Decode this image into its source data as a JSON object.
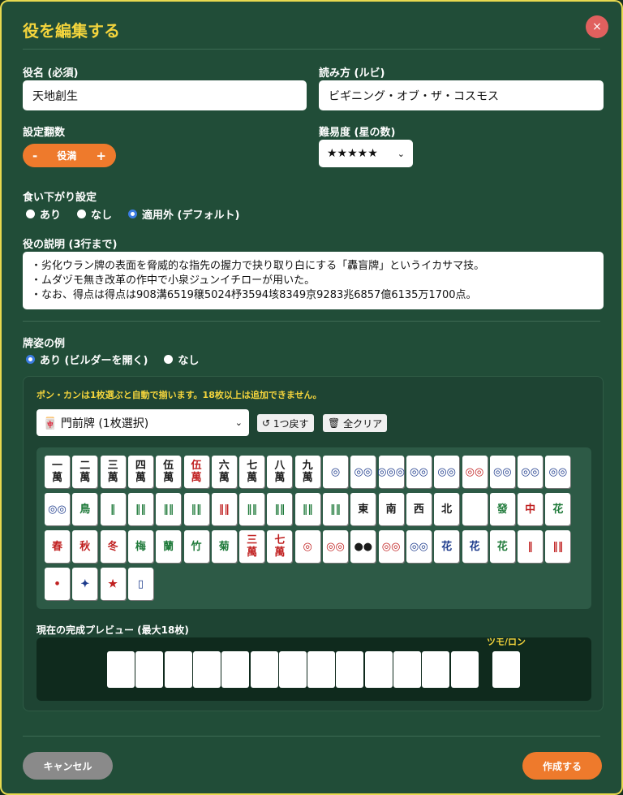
{
  "dialog": {
    "title": "役を編集する",
    "close_label": "×",
    "cancel_label": "キャンセル",
    "create_label": "作成する"
  },
  "fields": {
    "name_label": "役名 (必須)",
    "name_value": "天地創生",
    "reading_label": "読み方 (ルビ)",
    "reading_value": "ビギニング・オブ・ザ・コスモス",
    "han_label": "設定翻数",
    "han_minus": "-",
    "han_value": "役満",
    "han_plus": "+",
    "difficulty_label": "難易度 (星の数)",
    "difficulty_value": "★★★★★",
    "kuisagari_label": "食い下がり設定",
    "kuisagari_options": [
      "あり",
      "なし",
      "適用外 (デフォルト)"
    ],
    "kuisagari_selected": 2,
    "description_label": "役の説明 (3行まで)",
    "description_lines": [
      "・劣化ウラン牌の表面を脅威的な指先の握力で抉り取り白にする「轟盲牌」というイカサマ技。",
      "・ムダヅモ無き改革の作中で小泉ジュンイチローが用いた。",
      "・なお、得点は得点は908溝6519穣5024杼3594垓8349京9283兆6857億6135万1700点。"
    ],
    "example_label": "牌姿の例",
    "example_options": [
      "あり (ビルダーを開く)",
      "なし"
    ],
    "example_selected": 0
  },
  "builder": {
    "notice": "ポン・カンは1枚選ぶと自動で揃います。18枚以上は追加できません。",
    "tile_select_value": "門前牌 (1枚選択)",
    "tile_select_icon": "🀄",
    "undo_label": "1つ戻す",
    "undo_icon": "↺",
    "clear_label": "全クリア",
    "clear_icon": "🗑",
    "preview_label": "現在の完成プレビュー (最大18枚)",
    "tsumo_label": "ツモ/ロン",
    "tiles": [
      {
        "t": "一\n萬",
        "c": "bk"
      },
      {
        "t": "二\n萬",
        "c": "bk"
      },
      {
        "t": "三\n萬",
        "c": "bk"
      },
      {
        "t": "四\n萬",
        "c": "bk"
      },
      {
        "t": "伍\n萬",
        "c": "bk"
      },
      {
        "t": "伍\n萬",
        "c": "rd"
      },
      {
        "t": "六\n萬",
        "c": "bk"
      },
      {
        "t": "七\n萬",
        "c": "bk"
      },
      {
        "t": "八\n萬",
        "c": "bk"
      },
      {
        "t": "九\n萬",
        "c": "bk"
      },
      {
        "t": "◎",
        "c": "bl"
      },
      {
        "t": "◎◎",
        "c": "bl"
      },
      {
        "t": "◎◎◎",
        "c": "bl"
      },
      {
        "t": "◎◎",
        "c": "bl"
      },
      {
        "t": "◎◎",
        "c": "bl"
      },
      {
        "t": "◎◎",
        "c": "rd"
      },
      {
        "t": "◎◎",
        "c": "bl"
      },
      {
        "t": "◎◎",
        "c": "bl"
      },
      {
        "t": "◎◎",
        "c": "bl"
      },
      {
        "t": "◎◎",
        "c": "bl"
      },
      {
        "t": "鳥",
        "c": "gr"
      },
      {
        "t": "‖",
        "c": "gr"
      },
      {
        "t": "‖‖",
        "c": "gr"
      },
      {
        "t": "‖‖",
        "c": "gr"
      },
      {
        "t": "‖‖",
        "c": "gr"
      },
      {
        "t": "‖‖",
        "c": "rd"
      },
      {
        "t": "‖‖",
        "c": "gr"
      },
      {
        "t": "‖‖",
        "c": "gr"
      },
      {
        "t": "‖‖",
        "c": "gr"
      },
      {
        "t": "‖‖",
        "c": "gr"
      },
      {
        "t": "東",
        "c": "bk"
      },
      {
        "t": "南",
        "c": "bk"
      },
      {
        "t": "西",
        "c": "bk"
      },
      {
        "t": "北",
        "c": "bk"
      },
      {
        "t": "",
        "c": "bk"
      },
      {
        "t": "發",
        "c": "gr"
      },
      {
        "t": "中",
        "c": "rd"
      },
      {
        "t": "花",
        "c": "gr"
      },
      {
        "t": "春",
        "c": "rd"
      },
      {
        "t": "秋",
        "c": "rd"
      },
      {
        "t": "冬",
        "c": "rd"
      },
      {
        "t": "梅",
        "c": "gr"
      },
      {
        "t": "蘭",
        "c": "gr"
      },
      {
        "t": "竹",
        "c": "gr"
      },
      {
        "t": "菊",
        "c": "gr"
      },
      {
        "t": "三\n萬",
        "c": "rd"
      },
      {
        "t": "七\n萬",
        "c": "rd"
      },
      {
        "t": "◎",
        "c": "rd"
      },
      {
        "t": "◎◎",
        "c": "rd"
      },
      {
        "t": "●●",
        "c": "bk"
      },
      {
        "t": "◎◎",
        "c": "rd"
      },
      {
        "t": "◎◎",
        "c": "bl"
      },
      {
        "t": "花",
        "c": "bl"
      },
      {
        "t": "花",
        "c": "bl"
      },
      {
        "t": "花",
        "c": "gr"
      },
      {
        "t": "‖",
        "c": "rd"
      },
      {
        "t": "‖‖",
        "c": "rd"
      },
      {
        "t": "•",
        "c": "rd"
      },
      {
        "t": "✦",
        "c": "bl"
      },
      {
        "t": "★",
        "c": "rd"
      },
      {
        "t": "▯",
        "c": "bl"
      }
    ],
    "preview_slots": 13,
    "preview_tsumo_slots": 1
  }
}
